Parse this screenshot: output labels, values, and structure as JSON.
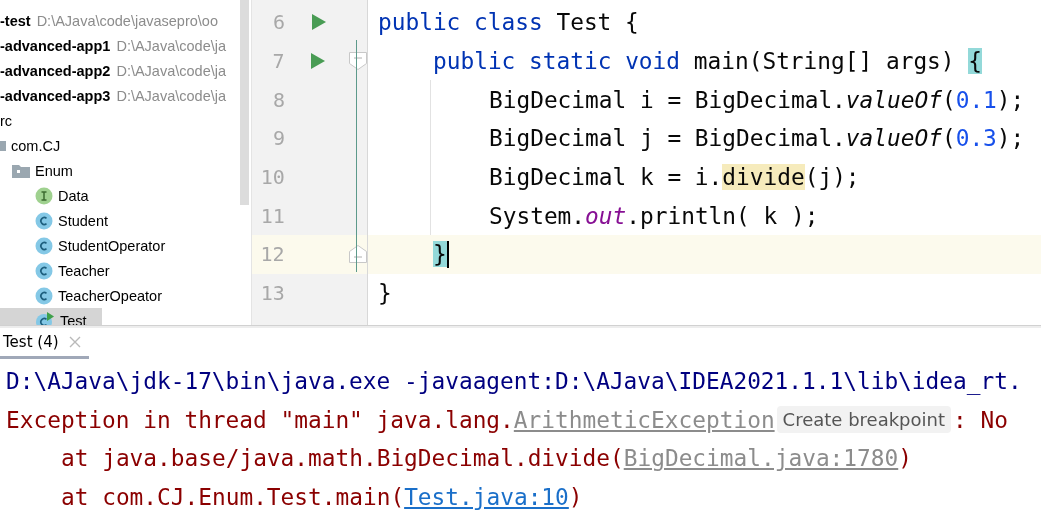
{
  "project_tree": [
    {
      "kind": "project",
      "name": "-test",
      "path": "D:\\AJava\\code\\javasepro\\oo",
      "selected": false
    },
    {
      "kind": "project",
      "name": "-advanced-app1",
      "path": "D:\\AJava\\code\\ja",
      "selected": false
    },
    {
      "kind": "project",
      "name": "-advanced-app2",
      "path": "D:\\AJava\\code\\ja",
      "selected": false
    },
    {
      "kind": "project",
      "name": "-advanced-app3",
      "path": "D:\\AJava\\code\\ja",
      "selected": false
    },
    {
      "kind": "source",
      "name": "rc",
      "selected": false,
      "children": [
        {
          "kind": "package",
          "name": "com.CJ",
          "selected": false,
          "children": [
            {
              "kind": "folder",
              "name": "Enum",
              "selected": false,
              "children": [
                {
                  "kind": "interface",
                  "name": "Data",
                  "selected": false
                },
                {
                  "kind": "class",
                  "name": "Student",
                  "selected": false
                },
                {
                  "kind": "class",
                  "name": "StudentOperator",
                  "selected": false
                },
                {
                  "kind": "class",
                  "name": "Teacher",
                  "selected": false
                },
                {
                  "kind": "class",
                  "name": "TeacherOpeator",
                  "selected": false
                },
                {
                  "kind": "runnable-class",
                  "name": "Test",
                  "selected": true
                }
              ]
            }
          ]
        }
      ]
    }
  ],
  "editor": {
    "lines": [
      {
        "number": "6",
        "kind": "top",
        "run": true,
        "fold_start": false,
        "fold_end": false,
        "current": false,
        "caret": false,
        "tokens": [
          {
            "kind": "kw",
            "text": "public class "
          },
          {
            "kind": "plain",
            "text": "Test {"
          }
        ]
      },
      {
        "number": "7",
        "kind": "member",
        "run": true,
        "fold_start": true,
        "fold_end": false,
        "current": false,
        "caret": false,
        "tokens": [
          {
            "kind": "kw",
            "text": "public static void "
          },
          {
            "kind": "plain",
            "text": "main(String[] args) "
          },
          {
            "kind": "brace-match",
            "text": "{"
          }
        ]
      },
      {
        "number": "8",
        "kind": "statement",
        "run": false,
        "fold_start": false,
        "fold_end": false,
        "current": false,
        "caret": false,
        "tokens": [
          {
            "kind": "plain",
            "text": "BigDecimal i = BigDecimal."
          },
          {
            "kind": "static-method",
            "text": "valueOf"
          },
          {
            "kind": "plain",
            "text": "("
          },
          {
            "kind": "num",
            "text": "0.1"
          },
          {
            "kind": "plain",
            "text": ");"
          }
        ]
      },
      {
        "number": "9",
        "kind": "statement",
        "run": false,
        "fold_start": false,
        "fold_end": false,
        "current": false,
        "caret": false,
        "tokens": [
          {
            "kind": "plain",
            "text": "BigDecimal j = BigDecimal."
          },
          {
            "kind": "static-method",
            "text": "valueOf"
          },
          {
            "kind": "plain",
            "text": "("
          },
          {
            "kind": "num",
            "text": "0.3"
          },
          {
            "kind": "plain",
            "text": ");"
          }
        ]
      },
      {
        "number": "10",
        "kind": "statement",
        "run": false,
        "fold_start": false,
        "fold_end": false,
        "current": false,
        "caret": false,
        "tokens": [
          {
            "kind": "plain",
            "text": "BigDecimal k = i."
          },
          {
            "kind": "usage",
            "text": "divide"
          },
          {
            "kind": "plain",
            "text": "(j);"
          }
        ]
      },
      {
        "number": "11",
        "kind": "statement",
        "run": false,
        "fold_start": false,
        "fold_end": false,
        "current": false,
        "caret": false,
        "tokens": [
          {
            "kind": "plain",
            "text": "System."
          },
          {
            "kind": "static-field",
            "text": "out"
          },
          {
            "kind": "plain",
            "text": ".println( k );"
          }
        ]
      },
      {
        "number": "12",
        "kind": "member",
        "run": false,
        "fold_start": false,
        "fold_end": true,
        "current": true,
        "caret": true,
        "tokens": [
          {
            "kind": "brace-match",
            "text": "}"
          }
        ]
      },
      {
        "number": "13",
        "kind": "top",
        "run": false,
        "fold_start": false,
        "fold_end": false,
        "current": false,
        "caret": false,
        "tokens": [
          {
            "kind": "plain",
            "text": "}"
          }
        ]
      }
    ]
  },
  "run_panel": {
    "tabs": [
      {
        "label": "Test (4)",
        "selected": true
      }
    ],
    "lines": [
      {
        "indent": false,
        "segments": [
          {
            "kind": "command",
            "text": "D:\\AJava\\jdk-17\\bin\\java.exe -javaagent:D:\\AJava\\IDEA2021.1.1\\lib\\idea_rt."
          }
        ]
      },
      {
        "indent": false,
        "segments": [
          {
            "kind": "error",
            "text": "Exception in thread \"main\" java.lang."
          },
          {
            "kind": "class-link",
            "text": "ArithmeticException"
          },
          {
            "kind": "hint",
            "text": "Create breakpoint"
          },
          {
            "kind": "error",
            "text": ": No"
          }
        ]
      },
      {
        "indent": true,
        "segments": [
          {
            "kind": "error",
            "text": "at java.base/java.math.BigDecimal.divide("
          },
          {
            "kind": "library-link",
            "text": "BigDecimal.java:1780"
          },
          {
            "kind": "error",
            "text": ")"
          }
        ]
      },
      {
        "indent": true,
        "segments": [
          {
            "kind": "error",
            "text": "at com.CJ.Enum.Test.main("
          },
          {
            "kind": "source-link",
            "text": "Test.java:10"
          },
          {
            "kind": "error",
            "text": ")"
          }
        ]
      }
    ]
  }
}
